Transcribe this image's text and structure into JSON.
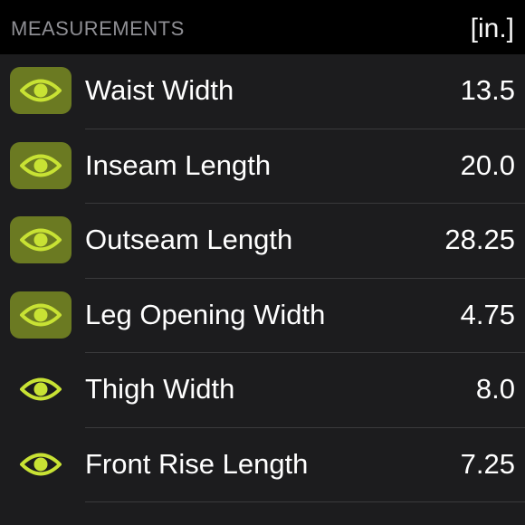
{
  "header": {
    "title": "MEASUREMENTS",
    "unit": "[in.]"
  },
  "colors": {
    "accent_eye": "#c8e234",
    "toggle_on_bg": "#6b7a22",
    "background": "#1c1c1e",
    "header_bg": "#000000"
  },
  "measurements": [
    {
      "label": "Waist Width",
      "value": "13.5",
      "visible": true,
      "icon": "eye-icon"
    },
    {
      "label": "Inseam Length",
      "value": "20.0",
      "visible": true,
      "icon": "eye-icon"
    },
    {
      "label": "Outseam Length",
      "value": "28.25",
      "visible": true,
      "icon": "eye-icon"
    },
    {
      "label": "Leg Opening Width",
      "value": "4.75",
      "visible": true,
      "icon": "eye-icon"
    },
    {
      "label": "Thigh Width",
      "value": "8.0",
      "visible": false,
      "icon": "eye-icon"
    },
    {
      "label": "Front Rise Length",
      "value": "7.25",
      "visible": false,
      "icon": "eye-icon"
    }
  ]
}
